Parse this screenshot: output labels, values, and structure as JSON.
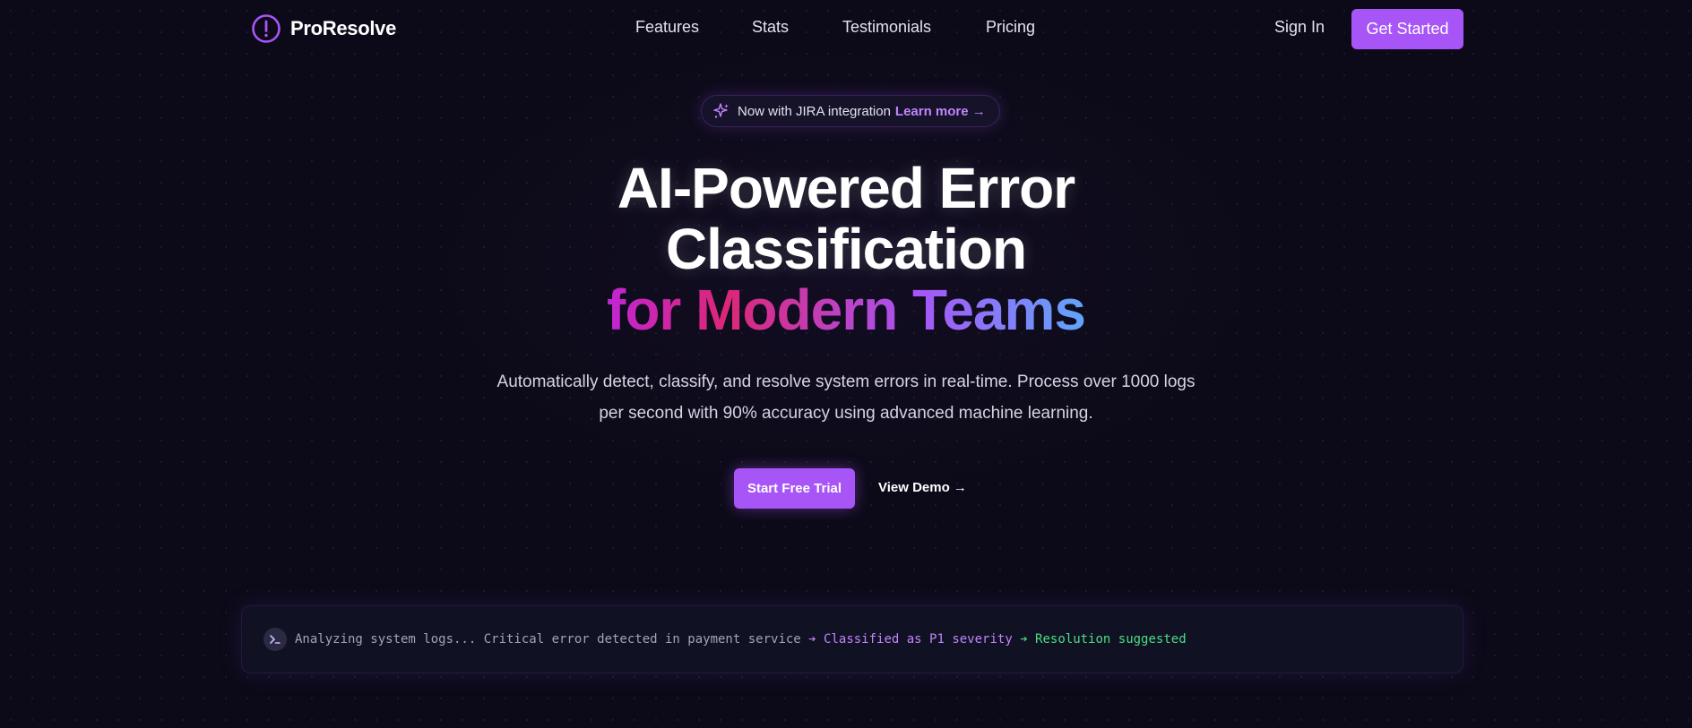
{
  "brand": {
    "name": "ProResolve",
    "icon": "alert-circle-icon"
  },
  "nav": {
    "links": [
      "Features",
      "Stats",
      "Testimonials",
      "Pricing"
    ],
    "sign_in": "Sign In",
    "get_started": "Get Started"
  },
  "announcement": {
    "icon": "sparkles-icon",
    "text": "Now with JIRA integration",
    "link": "Learn more →"
  },
  "hero": {
    "title_line1": "AI-Powered Error",
    "title_line2": "Classification",
    "title_highlight": "for Modern Teams",
    "subtitle": "Automatically detect, classify, and resolve system errors in real-time. Process over 1000 logs per second with 90% accuracy using advanced machine learning.",
    "primary_cta": "Start Free Trial",
    "secondary_cta": "View Demo →"
  },
  "terminal": {
    "icon": "terminal-icon",
    "text": "Analyzing system logs... Critical error detected in payment service",
    "step1": "➔ Classified as P1 severity",
    "step2": "➔ Resolution suggested"
  },
  "colors": {
    "background": "#0c0a18",
    "accent": "#a855f7",
    "gradient": [
      "#c026d3",
      "#db2777",
      "#a855f7",
      "#60a5fa"
    ],
    "success": "#4ade80"
  }
}
